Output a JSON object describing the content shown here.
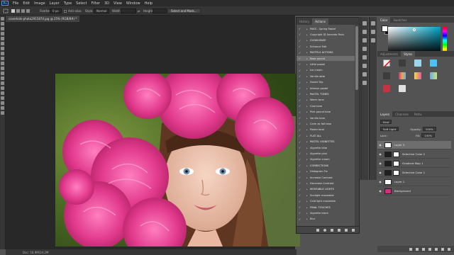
{
  "app": {
    "logo": "Ps",
    "menu": [
      "File",
      "Edit",
      "Image",
      "Layer",
      "Type",
      "Select",
      "Filter",
      "3D",
      "View",
      "Window",
      "Help"
    ]
  },
  "options": {
    "feather_label": "Feather:",
    "feather_value": "0 px",
    "antialias_label": "Anti-alias",
    "style_label": "Style:",
    "style_value": "Normal",
    "width_label": "Width:",
    "height_label": "Height:",
    "select_mask_button": "Select and Mask..."
  },
  "document": {
    "tab_title": "coverkids-photo2915874.jpg @ 25% (RGB/8#) *",
    "status": "Doc: 18.9M/34.2M"
  },
  "actions_panel": {
    "tabs": [
      "History",
      "Actions"
    ],
    "active_tab": "Actions",
    "items": [
      {
        "type": "item",
        "label": "PAKS - Spring Pastel",
        "checked": true
      },
      {
        "type": "item",
        "label": "Copyright @ Amanda Paris",
        "checked": true
      },
      {
        "type": "item",
        "label": "CLEAN BASE",
        "checked": true,
        "header": true
      },
      {
        "type": "item",
        "label": "Enhance Edit",
        "checked": true
      },
      {
        "type": "item",
        "label": "PASTELS ACTIONS",
        "checked": true,
        "header": true
      },
      {
        "type": "item",
        "label": "Rose pound",
        "checked": true,
        "selected": true
      },
      {
        "type": "item",
        "label": "Little pastel",
        "checked": true
      },
      {
        "type": "item",
        "label": "Ice cream",
        "checked": true
      },
      {
        "type": "item",
        "label": "Vanilla latte",
        "checked": true
      },
      {
        "type": "item",
        "label": "Sweet Sky",
        "checked": true
      },
      {
        "type": "item",
        "label": "Intense pastel",
        "checked": true
      },
      {
        "type": "item",
        "label": "PASTEL TONES",
        "checked": true,
        "header": true
      },
      {
        "type": "item",
        "label": "Warm tone",
        "checked": true
      },
      {
        "type": "item",
        "label": "Cool tone",
        "checked": true
      },
      {
        "type": "item",
        "label": "Pink pound tone",
        "checked": true
      },
      {
        "type": "item",
        "label": "Vanilla tone",
        "checked": true
      },
      {
        "type": "item",
        "label": "Calm as fall tone",
        "checked": true
      },
      {
        "type": "item",
        "label": "Pastel tone",
        "checked": true
      },
      {
        "type": "item",
        "label": "FLAT ALL",
        "checked": true,
        "header": true
      },
      {
        "type": "item",
        "label": "PASTEL VIGNETTES",
        "checked": true,
        "header": true
      },
      {
        "type": "item",
        "label": "Vignette blue",
        "checked": true
      },
      {
        "type": "item",
        "label": "Vignette pink",
        "checked": true
      },
      {
        "type": "item",
        "label": "Vignette cream",
        "checked": true
      },
      {
        "type": "item",
        "label": "CORRECTIONS",
        "checked": true,
        "header": true
      },
      {
        "type": "item",
        "label": "Histogram Fix",
        "checked": true
      },
      {
        "type": "item",
        "label": "Increase Contrast",
        "checked": true
      },
      {
        "type": "item",
        "label": "Decrease Contrast",
        "checked": true
      },
      {
        "type": "item",
        "label": "MOVEABLE LIGHTS",
        "checked": true,
        "header": true
      },
      {
        "type": "item",
        "label": "Sunlight moveable",
        "checked": true
      },
      {
        "type": "item",
        "label": "Cold light moveable",
        "checked": true
      },
      {
        "type": "item",
        "label": "FINAL TOUCHES",
        "checked": true,
        "header": true
      },
      {
        "type": "item",
        "label": "Vignette black",
        "checked": true
      },
      {
        "type": "item",
        "label": "Blur",
        "checked": true
      }
    ]
  },
  "color_panel": {
    "tabs": [
      "Color",
      "Swatches"
    ],
    "foreground": "#ffffff",
    "background": "#111111"
  },
  "adjustments_panel": {
    "tabs": [
      "Adjustments",
      "Styles"
    ],
    "active_tab": "Styles"
  },
  "layers_panel": {
    "tabs": [
      "Layers",
      "Channels",
      "Paths"
    ],
    "kind_label": "Kind",
    "blend_mode": "Soft Light",
    "opacity_label": "Opacity:",
    "opacity_value": "100%",
    "lock_label": "Lock:",
    "fill_label": "Fill:",
    "fill_value": "100%",
    "layers": [
      {
        "name": "Layer 3",
        "kind": "pixel",
        "selected": true
      },
      {
        "name": "Selective Color 2",
        "kind": "adjustment"
      },
      {
        "name": "Gradient Map 1",
        "kind": "adjustment"
      },
      {
        "name": "Selective Color 1",
        "kind": "adjustment"
      },
      {
        "name": "Layer 1",
        "kind": "pixel"
      },
      {
        "name": "Background",
        "kind": "photo",
        "italic": true
      }
    ]
  }
}
